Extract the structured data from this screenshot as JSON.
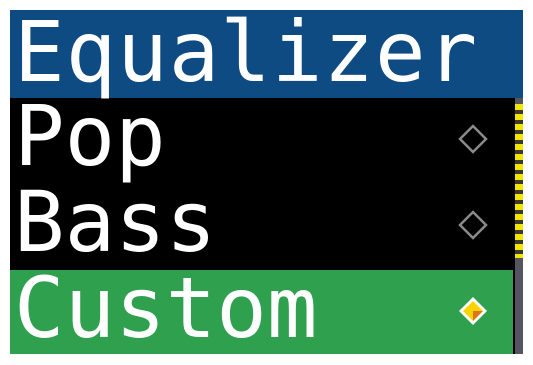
{
  "header": {
    "title": "Equalizer"
  },
  "menu": {
    "items": [
      {
        "label": "Pop",
        "selected": false,
        "indicator_icon": "radio-empty-diamond-icon"
      },
      {
        "label": "Bass",
        "selected": false,
        "indicator_icon": "radio-empty-diamond-icon"
      },
      {
        "label": "Custom",
        "selected": true,
        "indicator_icon": "radio-filled-diamond-icon"
      }
    ]
  },
  "colors": {
    "header_bg": "#0e4b82",
    "selected_bg": "#2ea04e",
    "text": "#ffffff",
    "radio_outline": "#8a8a8a",
    "radio_fill": "#f6d400",
    "radio_fill_accent": "#e0741a",
    "scroll_thumb": "#f2e600"
  },
  "scrollbar": {
    "visible_fraction": 0.6
  }
}
